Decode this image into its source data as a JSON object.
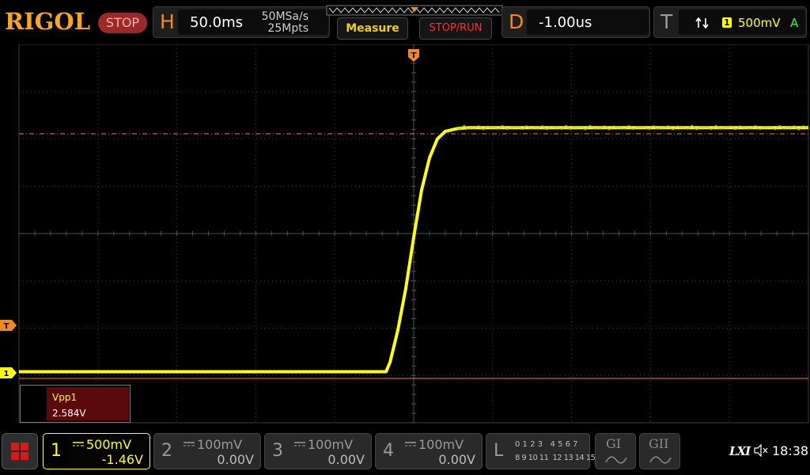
{
  "brand": "RIGOL",
  "run_state": "STOP",
  "horizontal": {
    "letter": "H",
    "timebase": "50.0ms",
    "sample_rate": "50MSa/s",
    "memory_depth": "25Mpts"
  },
  "buttons": {
    "measure": "Measure",
    "stop_run": "STOP/RUN"
  },
  "delay": {
    "letter": "D",
    "value": "-1.00us"
  },
  "trigger": {
    "letter": "T",
    "source": "1",
    "level": "500mV",
    "mode": "A"
  },
  "markers": {
    "trigger_top": "T",
    "trigger_left": "T",
    "ch1": "1"
  },
  "measurement": {
    "name": "Vpp1",
    "value": "2.584V"
  },
  "channels": [
    {
      "num": "1",
      "scale": "500mV",
      "offset": "-1.46V",
      "active": true
    },
    {
      "num": "2",
      "scale": "100mV",
      "offset": "0.00V",
      "active": false
    },
    {
      "num": "3",
      "scale": "100mV",
      "offset": "0.00V",
      "active": false
    },
    {
      "num": "4",
      "scale": "100mV",
      "offset": "0.00V",
      "active": false
    }
  ],
  "logic": {
    "letter": "L",
    "row1": "0 1 2 3   4 5 6 7",
    "row2": "8 9 10 11  12 13 14 15"
  },
  "generators": {
    "g1": "GI",
    "g2": "GII"
  },
  "status": {
    "lxi": "LXI",
    "time": "18:38"
  },
  "colors": {
    "ch1": "#ffff00",
    "orange": "#f08a1c",
    "run_state_bg": "#9a2a2a",
    "meas_bg": "#5a0a0a",
    "trigger_line": "#ff7a2a"
  },
  "chart_data": {
    "type": "line",
    "series": [
      {
        "color": "#ffff00",
        "x": [
          -5.0,
          -0.35,
          -0.3,
          -0.2,
          -0.1,
          0.0,
          0.1,
          0.2,
          0.3,
          0.4,
          0.55,
          0.7,
          1.0,
          1.5,
          2.0,
          3.0,
          4.0,
          5.0
        ],
        "y": [
          -1.46,
          -1.46,
          -1.36,
          -1.02,
          -0.58,
          -0.04,
          0.46,
          0.8,
          1.0,
          1.08,
          1.11,
          1.12,
          1.12,
          1.12,
          1.12,
          1.12,
          1.12,
          1.12
        ]
      }
    ],
    "x_divisions": 10,
    "y_divisions": 8,
    "xlim": [
      -5,
      5
    ],
    "ylim": [
      -2,
      2
    ],
    "grid": true
  }
}
